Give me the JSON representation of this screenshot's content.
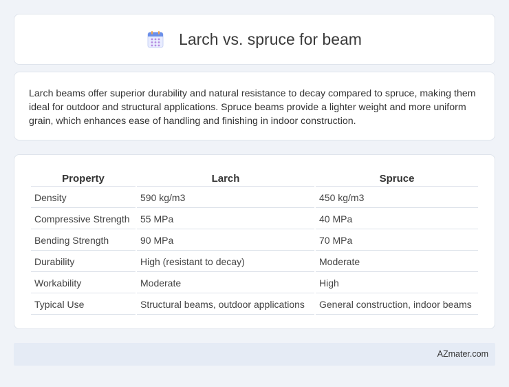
{
  "header": {
    "title": "Larch vs. spruce for beam",
    "icon": "calendar-icon"
  },
  "intro": {
    "text": "Larch beams offer superior durability and natural resistance to decay compared to spruce, making them ideal for outdoor and structural applications. Spruce beams provide a lighter weight and more uniform grain, which enhances ease of handling and finishing in indoor construction."
  },
  "table": {
    "headers": [
      "Property",
      "Larch",
      "Spruce"
    ],
    "rows": [
      [
        "Density",
        "590 kg/m3",
        "450 kg/m3"
      ],
      [
        "Compressive Strength",
        "55 MPa",
        "40 MPa"
      ],
      [
        "Bending Strength",
        "90 MPa",
        "70 MPa"
      ],
      [
        "Durability",
        "High (resistant to decay)",
        "Moderate"
      ],
      [
        "Workability",
        "Moderate",
        "High"
      ],
      [
        "Typical Use",
        "Structural beams, outdoor applications",
        "General construction, indoor beams"
      ]
    ]
  },
  "footer": {
    "brand": "AZmater.com"
  },
  "colors": {
    "background": "#f0f3f8",
    "icon_accent": "#6b8fe8",
    "footer_bg": "#e5ebf5"
  }
}
